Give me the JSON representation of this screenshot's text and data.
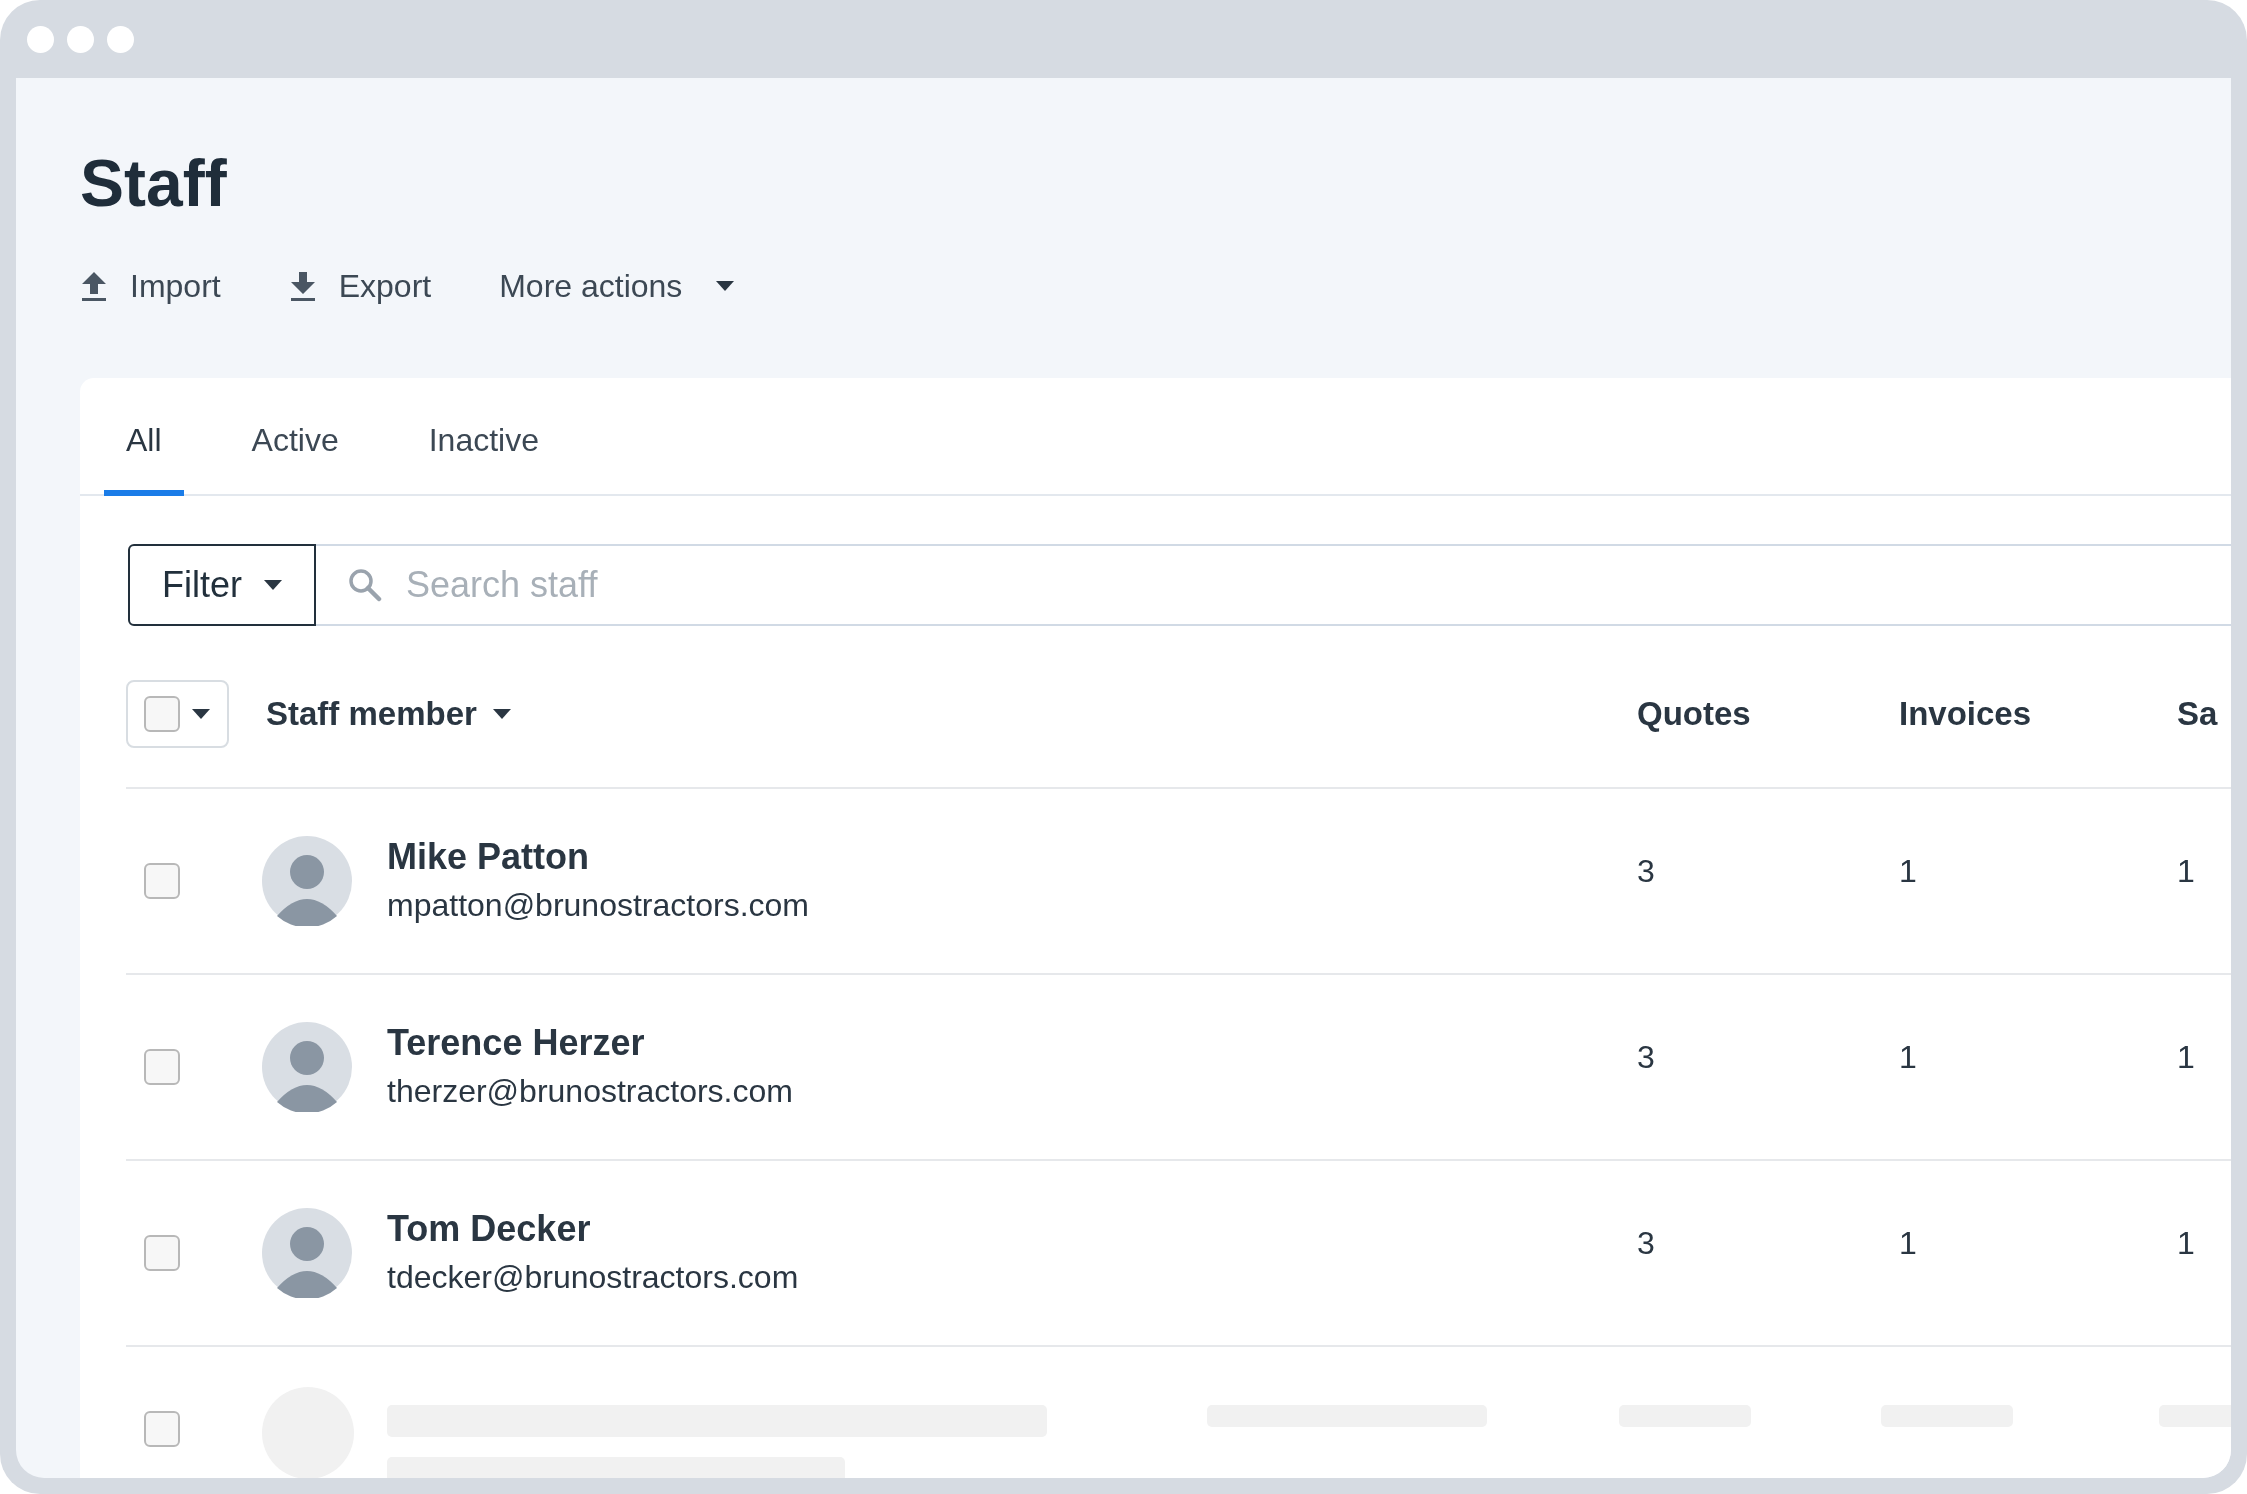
{
  "page": {
    "title": "Staff"
  },
  "actions": [
    {
      "label": "Import",
      "kind": "import"
    },
    {
      "label": "Export",
      "kind": "export"
    },
    {
      "label": "More actions",
      "kind": "menu"
    }
  ],
  "tabs": [
    {
      "label": "All",
      "selected": true
    },
    {
      "label": "Active",
      "selected": false
    },
    {
      "label": "Inactive",
      "selected": false
    }
  ],
  "filter": {
    "label": "Filter"
  },
  "search": {
    "placeholder": "Search staff"
  },
  "table": {
    "select_all": {
      "checked": false
    },
    "columns": [
      "Staff member",
      "Quotes",
      "Invoices",
      "Sa"
    ],
    "rows": [
      {
        "kind": "staff",
        "checked": false,
        "name": "Mike Patton",
        "email": "mpatton@brunostractors.com",
        "cells": [
          "3",
          "1",
          "1"
        ]
      },
      {
        "kind": "staff",
        "checked": false,
        "name": "Terence Herzer",
        "email": "therzer@brunostractors.com",
        "cells": [
          "3",
          "1",
          "1"
        ]
      },
      {
        "kind": "staff",
        "checked": false,
        "name": "Tom Decker",
        "email": "tdecker@brunostractors.com",
        "cells": [
          "3",
          "1",
          "1"
        ]
      },
      {
        "kind": "placeholder",
        "checked": false
      }
    ]
  }
}
